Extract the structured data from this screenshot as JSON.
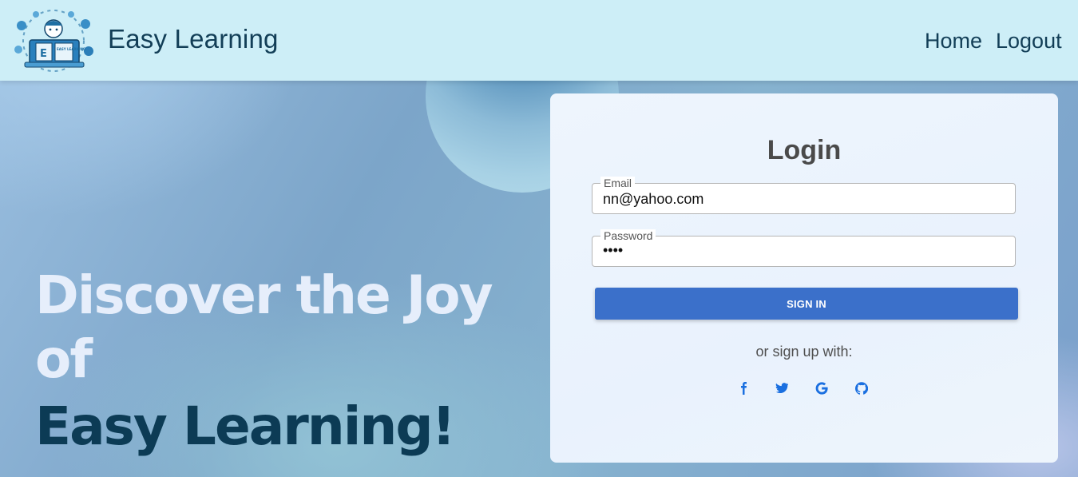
{
  "brand": {
    "name": "Easy Learning",
    "logo_text": "EASY LEARNING",
    "logo_initial": "E"
  },
  "nav": {
    "home": "Home",
    "logout": "Logout"
  },
  "hero": {
    "line1": "Discover the Joy of",
    "line2": "Easy Learning!"
  },
  "login": {
    "title": "Login",
    "email_label": "Email",
    "email_value": "nn@yahoo.com",
    "password_label": "Password",
    "password_value": "••••",
    "submit_label": "SIGN IN",
    "alt_text": "or sign up with:",
    "socials": [
      "facebook-icon",
      "twitter-icon",
      "google-icon",
      "github-icon"
    ]
  },
  "colors": {
    "navbar_bg": "#cdeef7",
    "nav_text": "#123e57",
    "button": "#3b70ca",
    "social_icon": "#1a6fe0",
    "hero_light": "#e6eefb",
    "hero_dark": "#0c3b55"
  }
}
